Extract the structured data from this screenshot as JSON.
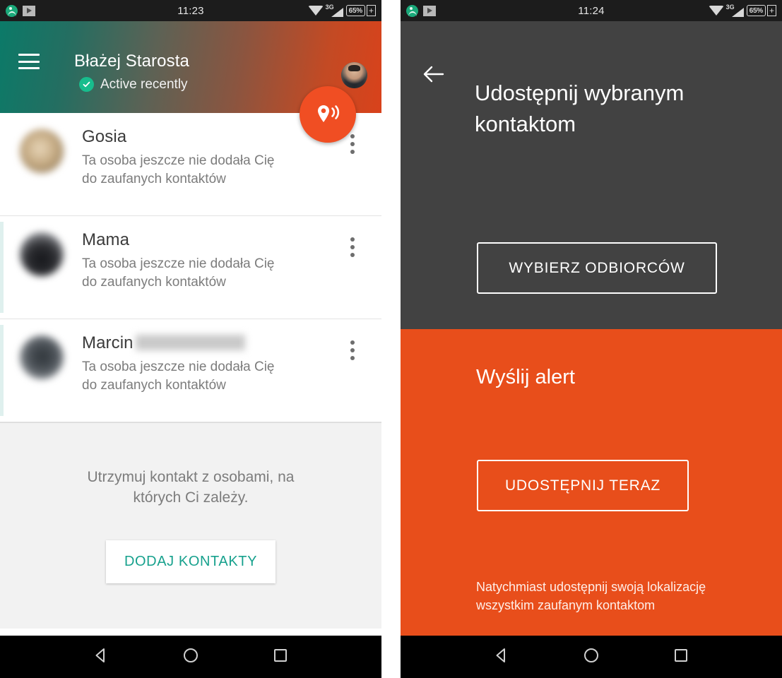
{
  "left_screen": {
    "status_bar": {
      "time": "11:23",
      "battery_label": "65%",
      "battery_charging_glyph": "+",
      "network_label": "3G",
      "icons": [
        "app-notification-icon",
        "play-store-icon",
        "wifi-icon",
        "signal-3g-icon",
        "battery-icon"
      ]
    },
    "header": {
      "menu_icon": "hamburger-menu-icon",
      "user_name": "Błażej Starosta",
      "status_text": "Active recently",
      "status_icon": "check-circle-icon",
      "avatar_icon": "user-avatar",
      "gradient_start_color": "#0b7a68",
      "gradient_end_color": "#d9421b"
    },
    "fab": {
      "icon": "location-broadcast-icon",
      "color": "#f04e23"
    },
    "contacts": [
      {
        "name": "Gosia",
        "subtitle_line1": "Ta osoba jeszcze nie dodała Cię",
        "subtitle_line2": "do zaufanych kontaktów",
        "redacted": false,
        "accent": false
      },
      {
        "name": "Mama",
        "subtitle_line1": "Ta osoba jeszcze nie dodała Cię",
        "subtitle_line2": "do zaufanych kontaktów",
        "redacted": false,
        "accent": true
      },
      {
        "name": "Marcin",
        "subtitle_line1": "Ta osoba jeszcze nie dodała Cię",
        "subtitle_line2": "do zaufanych kontaktów",
        "redacted": true,
        "accent": true
      }
    ],
    "cta": {
      "text_line1": "Utrzymuj kontakt z osobami, na",
      "text_line2": "których Ci zależy.",
      "button_label": "DODAJ KONTAKTY",
      "button_text_color": "#17a18d"
    },
    "nav_bar": {
      "back_icon": "nav-back-icon",
      "home_icon": "nav-home-icon",
      "recents_icon": "nav-recents-icon"
    }
  },
  "right_screen": {
    "status_bar": {
      "time": "11:24",
      "battery_label": "65%",
      "battery_charging_glyph": "+",
      "network_label": "3G"
    },
    "top_section": {
      "back_icon": "back-arrow-icon",
      "title": "Udostępnij wybranym kontaktom",
      "button_label": "WYBIERZ ODBIORCÓW",
      "background_color": "#424242"
    },
    "bottom_section": {
      "heading": "Wyślij alert",
      "button_label": "UDOSTĘPNIJ TERAZ",
      "note_line1": "Natychmiast udostępnij swoją lokalizację",
      "note_line2": "wszystkim zaufanym kontaktom",
      "background_color": "#e84e1b"
    },
    "nav_bar": {
      "back_icon": "nav-back-icon",
      "home_icon": "nav-home-icon",
      "recents_icon": "nav-recents-icon"
    }
  }
}
